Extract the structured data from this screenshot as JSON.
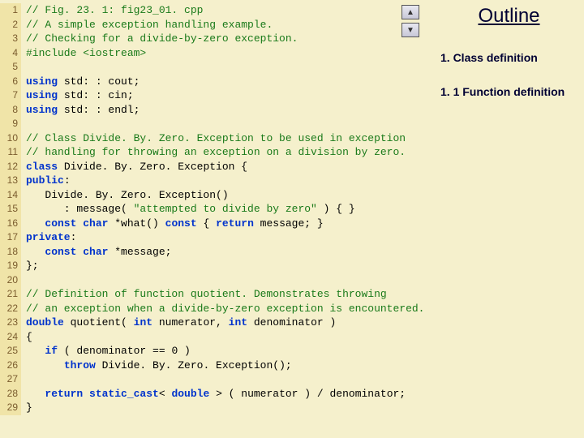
{
  "sidebar": {
    "title": "Outline",
    "items": [
      "1. Class definition",
      "1. 1 Function definition"
    ],
    "nav_up": "▲",
    "nav_down": "▼"
  },
  "code": [
    {
      "n": 1,
      "spans": [
        [
          "comment",
          "// Fig. 23. 1: fig23_01. cpp"
        ]
      ]
    },
    {
      "n": 2,
      "spans": [
        [
          "comment",
          "// A simple exception handling example."
        ]
      ]
    },
    {
      "n": 3,
      "spans": [
        [
          "comment",
          "// Checking for a divide-by-zero exception."
        ]
      ]
    },
    {
      "n": 4,
      "spans": [
        [
          "pre",
          "#include <iostream>"
        ]
      ]
    },
    {
      "n": 5,
      "spans": [
        [
          "normal",
          ""
        ]
      ]
    },
    {
      "n": 6,
      "spans": [
        [
          "keyword",
          "using"
        ],
        [
          "normal",
          " std: : cout;"
        ]
      ]
    },
    {
      "n": 7,
      "spans": [
        [
          "keyword",
          "using"
        ],
        [
          "normal",
          " std: : cin;"
        ]
      ]
    },
    {
      "n": 8,
      "spans": [
        [
          "keyword",
          "using"
        ],
        [
          "normal",
          " std: : endl;"
        ]
      ]
    },
    {
      "n": 9,
      "spans": [
        [
          "normal",
          ""
        ]
      ]
    },
    {
      "n": 10,
      "spans": [
        [
          "comment",
          "// Class Divide. By. Zero. Exception to be used in exception"
        ]
      ]
    },
    {
      "n": 11,
      "spans": [
        [
          "comment",
          "// handling for throwing an exception on a division by zero."
        ]
      ]
    },
    {
      "n": 12,
      "spans": [
        [
          "keyword",
          "class"
        ],
        [
          "normal",
          " Divide. By. Zero. Exception {"
        ]
      ]
    },
    {
      "n": 13,
      "spans": [
        [
          "keyword",
          "public"
        ],
        [
          "normal",
          ":"
        ]
      ]
    },
    {
      "n": 14,
      "spans": [
        [
          "normal",
          "   Divide. By. Zero. Exception()"
        ]
      ]
    },
    {
      "n": 15,
      "spans": [
        [
          "normal",
          "      : message( "
        ],
        [
          "string",
          "\"attempted to divide by zero\""
        ],
        [
          "normal",
          " ) { }"
        ]
      ]
    },
    {
      "n": 16,
      "spans": [
        [
          "normal",
          "   "
        ],
        [
          "keyword",
          "const char"
        ],
        [
          "normal",
          " *what() "
        ],
        [
          "keyword",
          "const"
        ],
        [
          "normal",
          " { "
        ],
        [
          "keyword",
          "return"
        ],
        [
          "normal",
          " message; }"
        ]
      ]
    },
    {
      "n": 17,
      "spans": [
        [
          "keyword",
          "private"
        ],
        [
          "normal",
          ":"
        ]
      ]
    },
    {
      "n": 18,
      "spans": [
        [
          "normal",
          "   "
        ],
        [
          "keyword",
          "const char"
        ],
        [
          "normal",
          " *message;"
        ]
      ]
    },
    {
      "n": 19,
      "spans": [
        [
          "normal",
          "};"
        ]
      ]
    },
    {
      "n": 20,
      "spans": [
        [
          "normal",
          ""
        ]
      ]
    },
    {
      "n": 21,
      "spans": [
        [
          "comment",
          "// Definition of function quotient. Demonstrates throwing"
        ]
      ]
    },
    {
      "n": 22,
      "spans": [
        [
          "comment",
          "// an exception when a divide-by-zero exception is encountered."
        ]
      ]
    },
    {
      "n": 23,
      "spans": [
        [
          "keyword",
          "double"
        ],
        [
          "normal",
          " quotient( "
        ],
        [
          "keyword",
          "int"
        ],
        [
          "normal",
          " numerator, "
        ],
        [
          "keyword",
          "int"
        ],
        [
          "normal",
          " denominator )"
        ]
      ]
    },
    {
      "n": 24,
      "spans": [
        [
          "normal",
          "{"
        ]
      ]
    },
    {
      "n": 25,
      "spans": [
        [
          "normal",
          "   "
        ],
        [
          "keyword",
          "if"
        ],
        [
          "normal",
          " ( denominator == 0 )"
        ]
      ]
    },
    {
      "n": 26,
      "spans": [
        [
          "normal",
          "      "
        ],
        [
          "keyword",
          "throw"
        ],
        [
          "normal",
          " Divide. By. Zero. Exception();"
        ]
      ]
    },
    {
      "n": 27,
      "spans": [
        [
          "normal",
          ""
        ]
      ]
    },
    {
      "n": 28,
      "spans": [
        [
          "normal",
          "   "
        ],
        [
          "keyword",
          "return static_cast"
        ],
        [
          "normal",
          "< "
        ],
        [
          "keyword",
          "double"
        ],
        [
          "normal",
          " > ( numerator ) / denominator;"
        ]
      ]
    },
    {
      "n": 29,
      "spans": [
        [
          "normal",
          "}"
        ]
      ]
    }
  ]
}
